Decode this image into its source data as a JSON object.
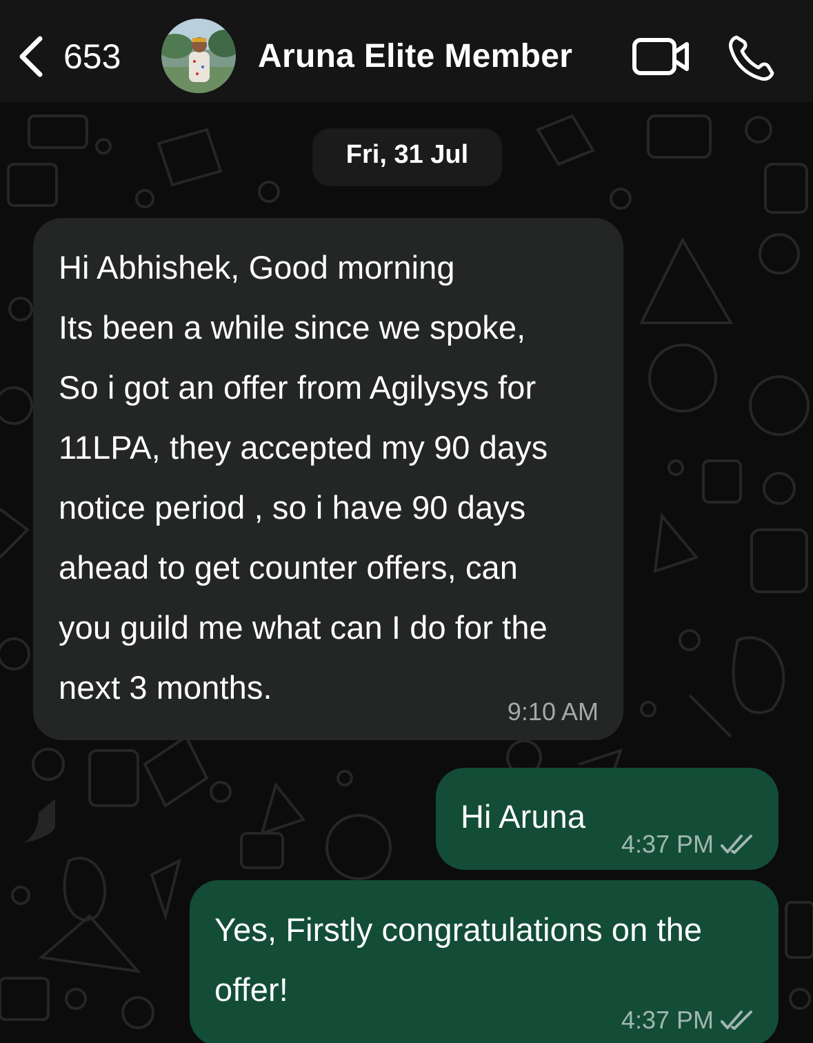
{
  "header": {
    "back_count": "653",
    "contact_name": "Aruna Elite Member"
  },
  "chat": {
    "date_label": "Fri, 31 Jul",
    "messages": [
      {
        "direction": "incoming",
        "text": "Hi Abhishek, Good morning\nIts been a while since we spoke,\nSo i got an offer from Agilysys for\n11LPA, they accepted my 90 days\nnotice period , so i have 90 days\nahead to get counter offers, can\nyou guild me what can I do for the\nnext 3 months.",
        "time": "9:10 AM"
      },
      {
        "direction": "outgoing",
        "text": "Hi Aruna",
        "time": "4:37 PM",
        "status": "read"
      },
      {
        "direction": "outgoing",
        "text": "Yes, Firstly congratulations on the\noffer!",
        "time": "4:37 PM",
        "status": "read"
      }
    ]
  },
  "colors": {
    "header_bg": "#151515",
    "chat_bg": "#0c0c0c",
    "incoming_bubble": "#242626",
    "outgoing_bubble": "#134d37",
    "meta_text": "#999999"
  },
  "icons": {
    "back": "chevron-left-icon",
    "video": "video-camera-icon",
    "call": "phone-icon",
    "read_receipt": "double-check-icon"
  }
}
